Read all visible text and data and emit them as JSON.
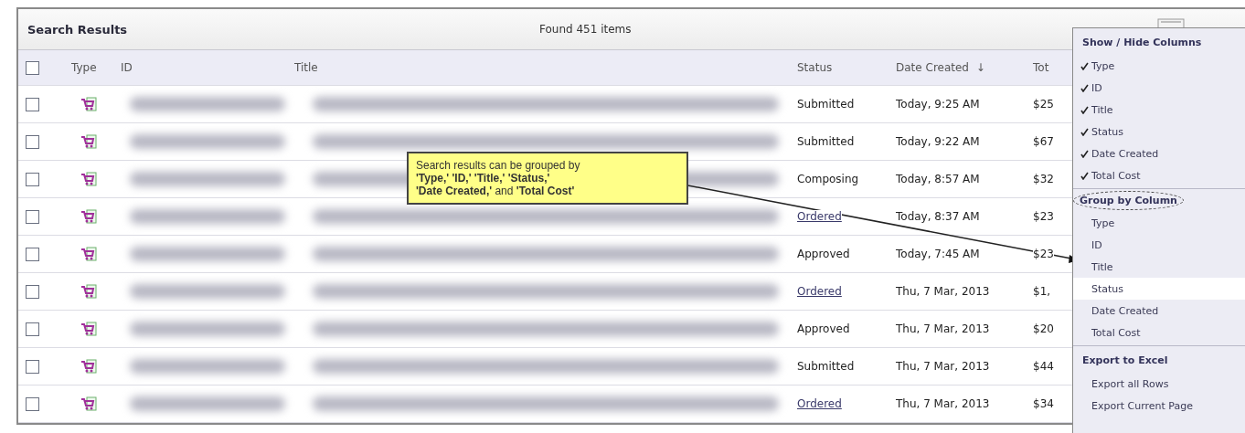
{
  "panel": {
    "title": "Search Results",
    "count": "Found 451 items"
  },
  "table": {
    "all_checked": false,
    "columns": [
      "Type",
      "ID",
      "Title",
      "Status",
      "Date Created",
      "Tot"
    ],
    "sort_indicator": "↓",
    "rows": [
      {
        "checked": false,
        "kind": "text",
        "status": "Submitted",
        "date": "Today, 9:25 AM",
        "total": "$25"
      },
      {
        "checked": false,
        "kind": "text",
        "status": "Submitted",
        "date": "Today, 9:22 AM",
        "total": "$67"
      },
      {
        "checked": false,
        "kind": "text",
        "status": "Composing",
        "date": "Today, 8:57 AM",
        "total": "$32"
      },
      {
        "checked": false,
        "kind": "link",
        "status": "Ordered",
        "date": "Today, 8:37 AM",
        "total": "$23"
      },
      {
        "checked": false,
        "kind": "text",
        "status": "Approved",
        "date": "Today, 7:45 AM",
        "total": "$23"
      },
      {
        "checked": false,
        "kind": "link",
        "status": "Ordered",
        "date": "Thu, 7 Mar, 2013",
        "total": "$1,"
      },
      {
        "checked": false,
        "kind": "text",
        "status": "Approved",
        "date": "Thu, 7 Mar, 2013",
        "total": "$20"
      },
      {
        "checked": false,
        "kind": "text",
        "status": "Submitted",
        "date": "Thu, 7 Mar, 2013",
        "total": "$44"
      },
      {
        "checked": false,
        "kind": "link",
        "status": "Ordered",
        "date": "Thu, 7 Mar, 2013",
        "total": "$34"
      }
    ]
  },
  "callout": {
    "text": "Search results can be grouped by\n**'Type,' 'ID,' 'Title,' 'Status,'**\n**'Date Created,'** and **'Total Cost'**"
  },
  "menu": {
    "sections": [
      {
        "title": "Show / Hide Columns",
        "circled": false,
        "items": [
          {
            "label": "Type",
            "checked": true,
            "highlighted": false
          },
          {
            "label": "ID",
            "checked": true,
            "highlighted": false
          },
          {
            "label": "Title",
            "checked": true,
            "highlighted": false
          },
          {
            "label": "Status",
            "checked": true,
            "highlighted": false
          },
          {
            "label": "Date Created",
            "checked": true,
            "highlighted": false
          },
          {
            "label": "Total Cost",
            "checked": true,
            "highlighted": false
          }
        ]
      },
      {
        "title": "Group by Column",
        "circled": true,
        "items": [
          {
            "label": "Type",
            "checked": false,
            "highlighted": false
          },
          {
            "label": "ID",
            "checked": false,
            "highlighted": false
          },
          {
            "label": "Title",
            "checked": false,
            "highlighted": false
          },
          {
            "label": "Status",
            "checked": false,
            "highlighted": true
          },
          {
            "label": "Date Created",
            "checked": false,
            "highlighted": false
          },
          {
            "label": "Total Cost",
            "checked": false,
            "highlighted": false
          }
        ]
      },
      {
        "title": "Export to Excel",
        "circled": false,
        "items": [
          {
            "label": "Export all Rows",
            "checked": false,
            "highlighted": false
          },
          {
            "label": "Export Current Page",
            "checked": false,
            "highlighted": false
          }
        ]
      }
    ]
  }
}
